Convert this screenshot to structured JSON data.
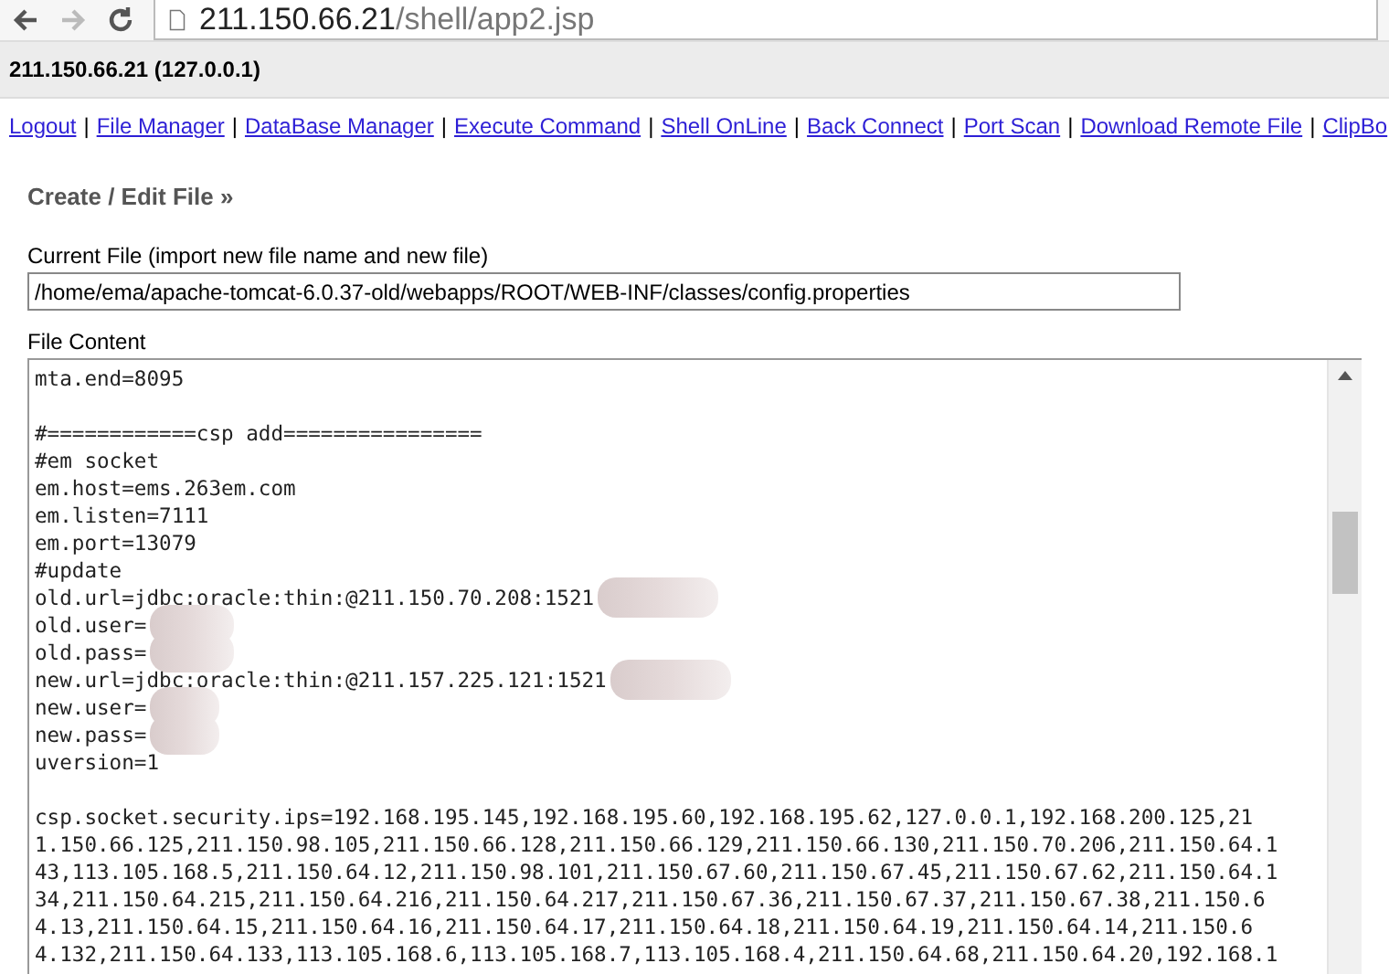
{
  "browser": {
    "url_host": "211.150.66.21",
    "url_path": "/shell/app2.jsp",
    "forward_disabled": true
  },
  "header": {
    "title": "211.150.66.21 (127.0.0.1)"
  },
  "nav": [
    {
      "kind": "link",
      "label": "Logout"
    },
    {
      "kind": "separator",
      "label": "|"
    },
    {
      "kind": "link",
      "label": "File Manager"
    },
    {
      "kind": "separator",
      "label": "|"
    },
    {
      "kind": "link",
      "label": "DataBase Manager"
    },
    {
      "kind": "separator",
      "label": "|"
    },
    {
      "kind": "link",
      "label": "Execute Command"
    },
    {
      "kind": "separator",
      "label": "|"
    },
    {
      "kind": "link",
      "label": "Shell OnLine"
    },
    {
      "kind": "separator",
      "label": "|"
    },
    {
      "kind": "link",
      "label": "Back Connect"
    },
    {
      "kind": "separator",
      "label": "|"
    },
    {
      "kind": "link",
      "label": "Port Scan"
    },
    {
      "kind": "separator",
      "label": "|"
    },
    {
      "kind": "link",
      "label": "Download Remote File"
    },
    {
      "kind": "separator",
      "label": "|"
    },
    {
      "kind": "link",
      "label": "ClipBo"
    }
  ],
  "section_title": "Create / Edit File »",
  "current_file": {
    "label": "Current File (import new file name and new file)",
    "value": "/home/ema/apache-tomcat-6.0.37-old/webapps/ROOT/WEB-INF/classes/config.properties"
  },
  "file_content": {
    "label": "File Content",
    "lines": [
      {
        "text": "mta.end=8095",
        "blurred": false
      },
      {
        "blurred": false
      },
      {
        "text": "#============csp add================",
        "blurred": false
      },
      {
        "text": "#em socket",
        "blurred": false
      },
      {
        "text": "em.host=ems.263em.com",
        "blurred": false
      },
      {
        "text": "em.listen=7111",
        "blurred": false
      },
      {
        "text": "em.port=13079",
        "blurred": false
      },
      {
        "text": "#update",
        "blurred": false
      },
      {
        "text": "old.url=jdbc:oracle:thin:@211.150.70.208:1521",
        "blurred": true
      },
      {
        "text": "old.user=",
        "blurred": true
      },
      {
        "text": "old.pass=",
        "blurred": true
      },
      {
        "text": "new.url=jdbc:oracle:thin:@211.157.225.121:1521",
        "blurred": true
      },
      {
        "text": "new.user=",
        "blurred": true
      },
      {
        "text": "new.pass=",
        "blurred": true
      },
      {
        "text": "uversion=1",
        "blurred": false
      },
      {
        "blurred": false
      },
      {
        "text": "csp.socket.security.ips=192.168.195.145,192.168.195.60,192.168.195.62,127.0.0.1,192.168.200.125,21",
        "blurred": false
      },
      {
        "text": "1.150.66.125,211.150.98.105,211.150.66.128,211.150.66.129,211.150.66.130,211.150.70.206,211.150.64.1",
        "blurred": false
      },
      {
        "text": "43,113.105.168.5,211.150.64.12,211.150.98.101,211.150.67.60,211.150.67.45,211.150.67.62,211.150.64.1",
        "blurred": false
      },
      {
        "text": "34,211.150.64.215,211.150.64.216,211.150.64.217,211.150.67.36,211.150.67.37,211.150.67.38,211.150.6",
        "blurred": false
      },
      {
        "text": "4.13,211.150.64.15,211.150.64.16,211.150.64.17,211.150.64.18,211.150.64.19,211.150.64.14,211.150.6",
        "blurred": false
      },
      {
        "text": "4.132,211.150.64.133,113.105.168.6,113.105.168.7,113.105.168.4,211.150.64.68,211.150.64.20,192.168.1",
        "blurred": false
      }
    ]
  }
}
